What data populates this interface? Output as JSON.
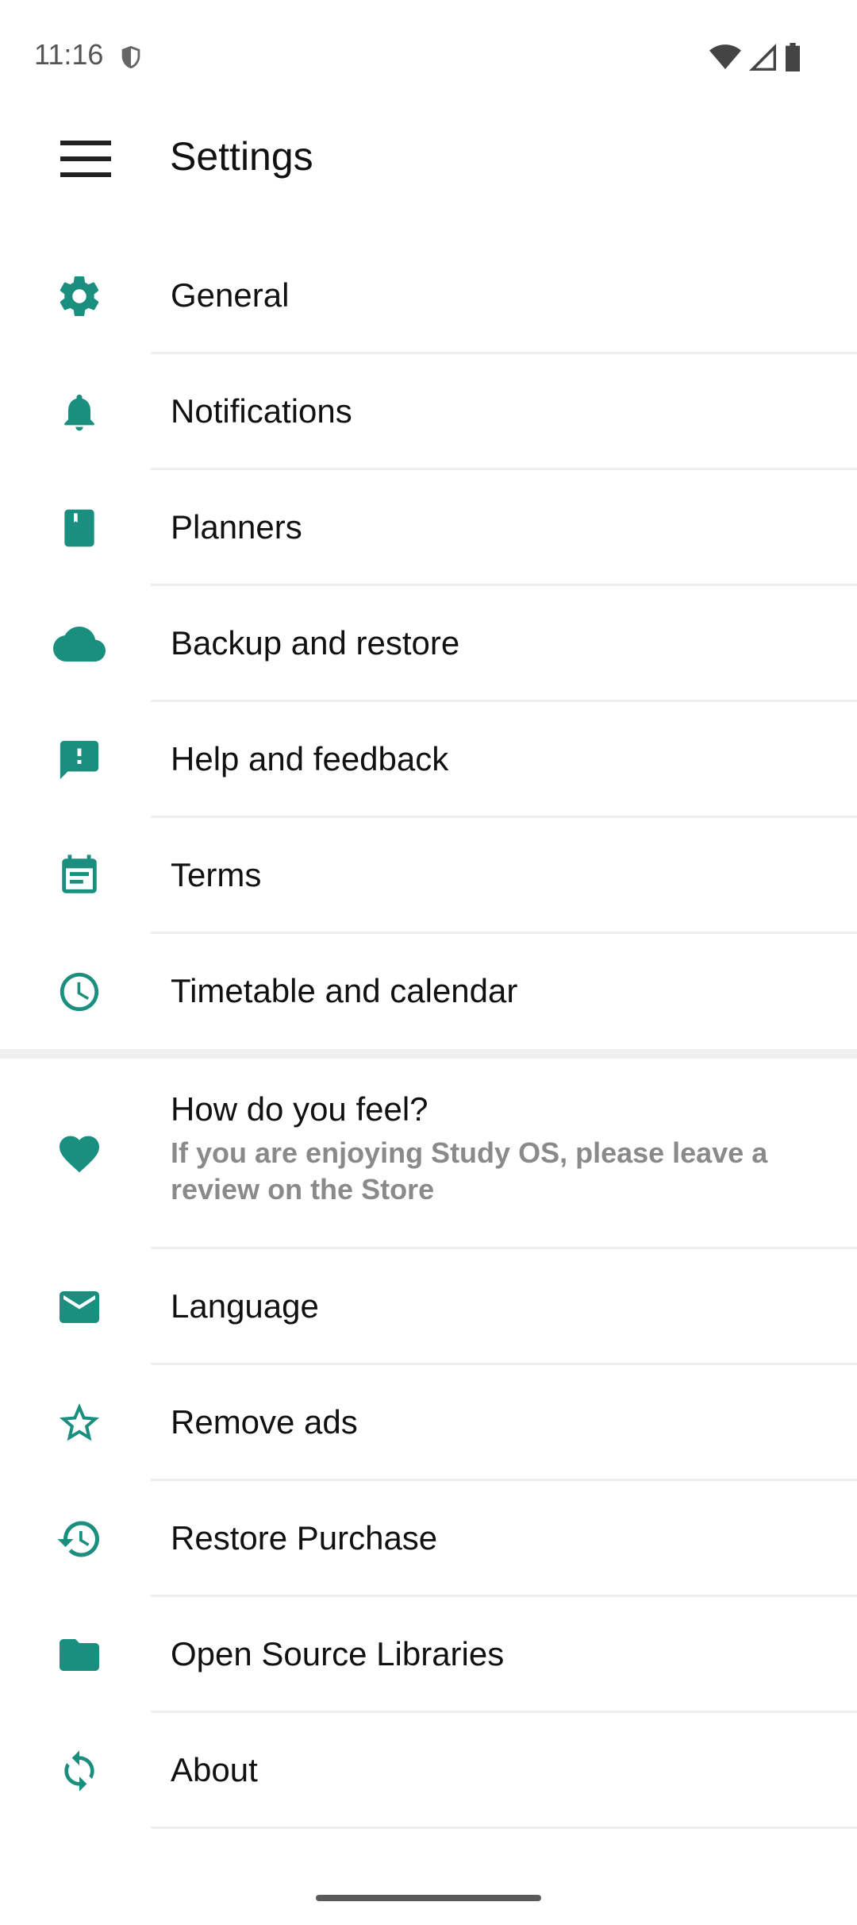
{
  "status_bar": {
    "time": "11:16",
    "icons": [
      "shield-icon",
      "wifi-icon",
      "cell-signal-icon",
      "battery-icon"
    ]
  },
  "app_bar": {
    "title": "Settings",
    "menu_icon": "hamburger-menu-icon"
  },
  "colors": {
    "accent": "#1a8f7f",
    "divider": "#eeeeee",
    "subtitle": "#8a8a8a"
  },
  "settings_items": [
    {
      "label": "General",
      "icon": "gear-icon"
    },
    {
      "label": "Notifications",
      "icon": "bell-icon"
    },
    {
      "label": "Planners",
      "icon": "book-icon"
    },
    {
      "label": "Backup and restore",
      "icon": "cloud-icon"
    },
    {
      "label": "Help and feedback",
      "icon": "feedback-icon"
    },
    {
      "label": "Terms",
      "icon": "calendar-note-icon"
    },
    {
      "label": "Timetable and calendar",
      "icon": "clock-icon"
    }
  ],
  "feel": {
    "title": "How do you feel?",
    "subtitle": "If you are enjoying Study OS, please leave a review on the Store",
    "icon": "heart-icon"
  },
  "other_items": [
    {
      "label": "Language",
      "icon": "mail-icon"
    },
    {
      "label": "Remove ads",
      "icon": "star-outline-icon"
    },
    {
      "label": "Restore Purchase",
      "icon": "history-icon"
    },
    {
      "label": "Open Source Libraries",
      "icon": "folder-icon"
    },
    {
      "label": "About",
      "icon": "sync-icon"
    }
  ]
}
